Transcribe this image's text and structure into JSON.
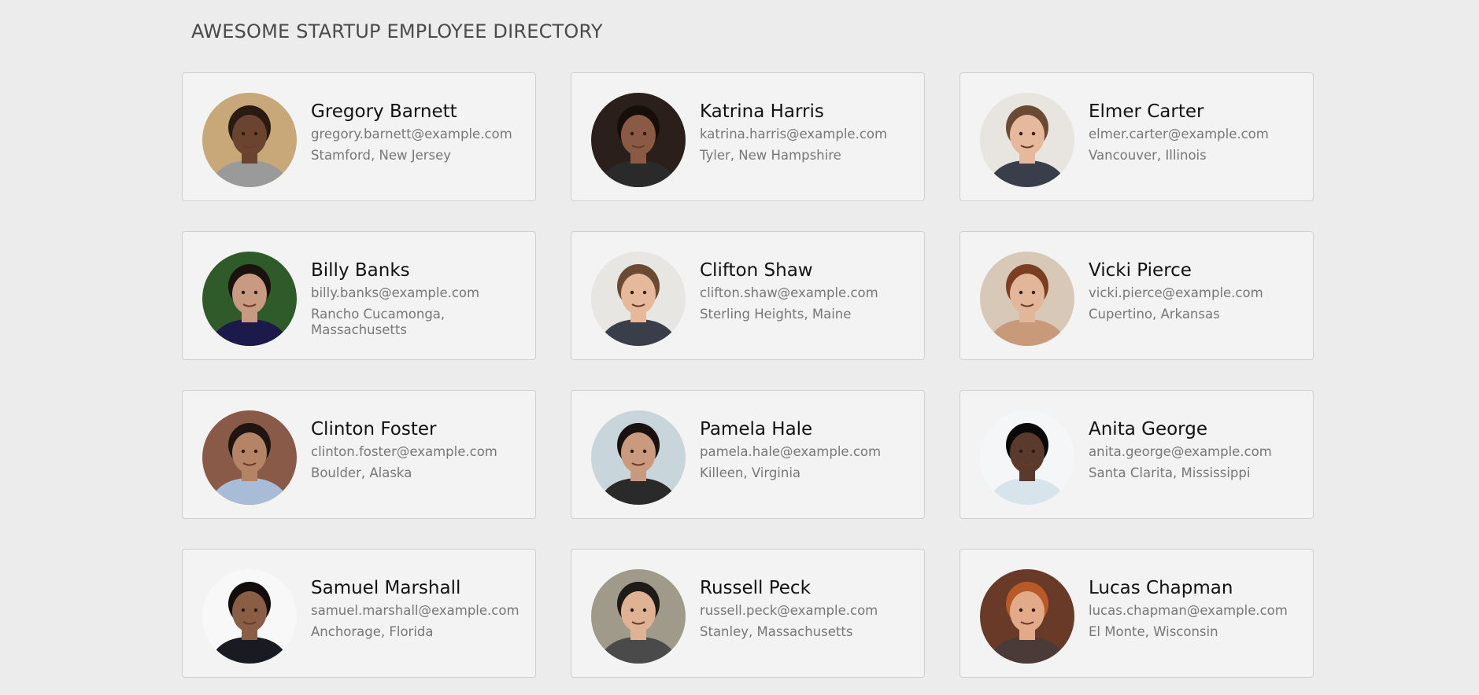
{
  "directory": {
    "title": "AWESOME STARTUP EMPLOYEE DIRECTORY",
    "employees": [
      {
        "name": "Gregory Barnett",
        "email": "gregory.barnett@example.com",
        "location": "Stamford, New Jersey",
        "bg": "#c8a878",
        "skin": "#6b4430",
        "hair": "#2a1a10",
        "shirt": "#9a9a9a"
      },
      {
        "name": "Katrina Harris",
        "email": "katrina.harris@example.com",
        "location": "Tyler, New Hampshire",
        "bg": "#2a1f1a",
        "skin": "#8a5a44",
        "hair": "#150e0a",
        "shirt": "#2a2a2a"
      },
      {
        "name": "Elmer Carter",
        "email": "elmer.carter@example.com",
        "location": "Vancouver, Illinois",
        "bg": "#e8e4df",
        "skin": "#e6b89c",
        "hair": "#6b4a33",
        "shirt": "#3a3e4a"
      },
      {
        "name": "Billy Banks",
        "email": "billy.banks@example.com",
        "location": "Rancho Cucamonga, Massachusetts",
        "bg": "#2f5a2a",
        "skin": "#c99a82",
        "hair": "#1a120e",
        "shirt": "#1c1a4a"
      },
      {
        "name": "Clifton Shaw",
        "email": "clifton.shaw@example.com",
        "location": "Sterling Heights, Maine",
        "bg": "#e8e6e2",
        "skin": "#e6b89c",
        "hair": "#6b4a33",
        "shirt": "#3a3e4a"
      },
      {
        "name": "Vicki Pierce",
        "email": "vicki.pierce@example.com",
        "location": "Cupertino, Arkansas",
        "bg": "#d8c8b8",
        "skin": "#e3b69a",
        "hair": "#7a3f22",
        "shirt": "#c89a7a"
      },
      {
        "name": "Clinton Foster",
        "email": "clinton.foster@example.com",
        "location": "Boulder, Alaska",
        "bg": "#8a5a48",
        "skin": "#b58466",
        "hair": "#1e1410",
        "shirt": "#a8bcd8"
      },
      {
        "name": "Pamela Hale",
        "email": "pamela.hale@example.com",
        "location": "Killeen, Virginia",
        "bg": "#c8d6dc",
        "skin": "#c99a7e",
        "hair": "#1a1210",
        "shirt": "#2a2a2a"
      },
      {
        "name": "Anita George",
        "email": "anita.george@example.com",
        "location": "Santa Clarita, Mississippi",
        "bg": "#f4f6f8",
        "skin": "#5a3a2c",
        "hair": "#0a0808",
        "shirt": "#d8e4ec"
      },
      {
        "name": "Samuel Marshall",
        "email": "samuel.marshall@example.com",
        "location": "Anchorage, Florida",
        "bg": "#f8f8f8",
        "skin": "#8a5e44",
        "hair": "#120c0a",
        "shirt": "#1a1a22"
      },
      {
        "name": "Russell Peck",
        "email": "russell.peck@example.com",
        "location": "Stanley, Massachusetts",
        "bg": "#a09a8a",
        "skin": "#e0b294",
        "hair": "#1e1a18",
        "shirt": "#4a4a4a"
      },
      {
        "name": "Lucas Chapman",
        "email": "lucas.chapman@example.com",
        "location": "El Monte, Wisconsin",
        "bg": "#6a3a28",
        "skin": "#e2aa88",
        "hair": "#b85a28",
        "shirt": "#4a3a38"
      }
    ]
  }
}
